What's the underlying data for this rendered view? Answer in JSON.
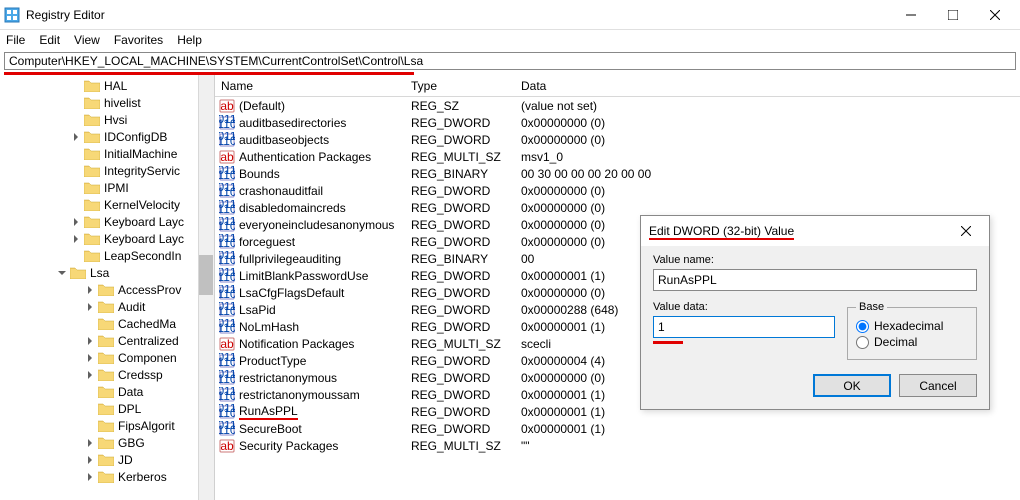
{
  "window": {
    "title": "Registry Editor"
  },
  "menu": {
    "file": "File",
    "edit": "Edit",
    "view": "View",
    "favorites": "Favorites",
    "help": "Help"
  },
  "address": "Computer\\HKEY_LOCAL_MACHINE\\SYSTEM\\CurrentControlSet\\Control\\Lsa",
  "tree": [
    {
      "indent": 5,
      "expand": "",
      "label": "HAL"
    },
    {
      "indent": 5,
      "expand": "",
      "label": "hivelist"
    },
    {
      "indent": 5,
      "expand": "",
      "label": "Hvsi"
    },
    {
      "indent": 5,
      "expand": ">",
      "label": "IDConfigDB"
    },
    {
      "indent": 5,
      "expand": "",
      "label": "InitialMachine"
    },
    {
      "indent": 5,
      "expand": "",
      "label": "IntegrityServic"
    },
    {
      "indent": 5,
      "expand": "",
      "label": "IPMI"
    },
    {
      "indent": 5,
      "expand": "",
      "label": "KernelVelocity"
    },
    {
      "indent": 5,
      "expand": ">",
      "label": "Keyboard Layc"
    },
    {
      "indent": 5,
      "expand": ">",
      "label": "Keyboard Layc"
    },
    {
      "indent": 5,
      "expand": "",
      "label": "LeapSecondIn"
    },
    {
      "indent": 4,
      "expand": "v",
      "label": "Lsa"
    },
    {
      "indent": 6,
      "expand": ">",
      "label": "AccessProv"
    },
    {
      "indent": 6,
      "expand": ">",
      "label": "Audit"
    },
    {
      "indent": 6,
      "expand": "",
      "label": "CachedMa"
    },
    {
      "indent": 6,
      "expand": ">",
      "label": "Centralized"
    },
    {
      "indent": 6,
      "expand": ">",
      "label": "Componen"
    },
    {
      "indent": 6,
      "expand": ">",
      "label": "Credssp"
    },
    {
      "indent": 6,
      "expand": "",
      "label": "Data"
    },
    {
      "indent": 6,
      "expand": "",
      "label": "DPL"
    },
    {
      "indent": 6,
      "expand": "",
      "label": "FipsAlgorit"
    },
    {
      "indent": 6,
      "expand": ">",
      "label": "GBG"
    },
    {
      "indent": 6,
      "expand": ">",
      "label": "JD"
    },
    {
      "indent": 6,
      "expand": ">",
      "label": "Kerberos"
    }
  ],
  "columns": {
    "name": "Name",
    "type": "Type",
    "data": "Data"
  },
  "values": [
    {
      "icon": "sz",
      "name": "(Default)",
      "type": "REG_SZ",
      "data": "(value not set)"
    },
    {
      "icon": "bn",
      "name": "auditbasedirectories",
      "type": "REG_DWORD",
      "data": "0x00000000 (0)"
    },
    {
      "icon": "bn",
      "name": "auditbaseobjects",
      "type": "REG_DWORD",
      "data": "0x00000000 (0)"
    },
    {
      "icon": "sz",
      "name": "Authentication Packages",
      "type": "REG_MULTI_SZ",
      "data": "msv1_0"
    },
    {
      "icon": "bn",
      "name": "Bounds",
      "type": "REG_BINARY",
      "data": "00 30 00 00 00 20 00 00"
    },
    {
      "icon": "bn",
      "name": "crashonauditfail",
      "type": "REG_DWORD",
      "data": "0x00000000 (0)"
    },
    {
      "icon": "bn",
      "name": "disabledomaincreds",
      "type": "REG_DWORD",
      "data": "0x00000000 (0)"
    },
    {
      "icon": "bn",
      "name": "everyoneincludesanonymous",
      "type": "REG_DWORD",
      "data": "0x00000000 (0)"
    },
    {
      "icon": "bn",
      "name": "forceguest",
      "type": "REG_DWORD",
      "data": "0x00000000 (0)"
    },
    {
      "icon": "bn",
      "name": "fullprivilegeauditing",
      "type": "REG_BINARY",
      "data": "00"
    },
    {
      "icon": "bn",
      "name": "LimitBlankPasswordUse",
      "type": "REG_DWORD",
      "data": "0x00000001 (1)"
    },
    {
      "icon": "bn",
      "name": "LsaCfgFlagsDefault",
      "type": "REG_DWORD",
      "data": "0x00000000 (0)"
    },
    {
      "icon": "bn",
      "name": "LsaPid",
      "type": "REG_DWORD",
      "data": "0x00000288 (648)"
    },
    {
      "icon": "bn",
      "name": "NoLmHash",
      "type": "REG_DWORD",
      "data": "0x00000001 (1)"
    },
    {
      "icon": "sz",
      "name": "Notification Packages",
      "type": "REG_MULTI_SZ",
      "data": "scecli"
    },
    {
      "icon": "bn",
      "name": "ProductType",
      "type": "REG_DWORD",
      "data": "0x00000004 (4)"
    },
    {
      "icon": "bn",
      "name": "restrictanonymous",
      "type": "REG_DWORD",
      "data": "0x00000000 (0)"
    },
    {
      "icon": "bn",
      "name": "restrictanonymoussam",
      "type": "REG_DWORD",
      "data": "0x00000001 (1)"
    },
    {
      "icon": "bn",
      "name": "RunAsPPL",
      "type": "REG_DWORD",
      "data": "0x00000001 (1)",
      "hl": true
    },
    {
      "icon": "bn",
      "name": "SecureBoot",
      "type": "REG_DWORD",
      "data": "0x00000001 (1)"
    },
    {
      "icon": "sz",
      "name": "Security Packages",
      "type": "REG_MULTI_SZ",
      "data": "\"\""
    }
  ],
  "dialog": {
    "title": "Edit DWORD (32-bit) Value",
    "valuename_label": "Value name:",
    "valuename": "RunAsPPL",
    "valuedata_label": "Value data:",
    "valuedata": "1",
    "base_label": "Base",
    "hex": "Hexadecimal",
    "dec": "Decimal",
    "ok": "OK",
    "cancel": "Cancel"
  }
}
